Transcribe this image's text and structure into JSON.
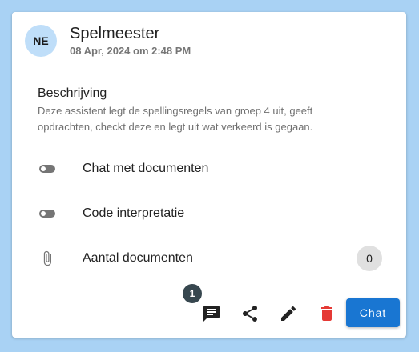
{
  "card": {
    "avatar_initials": "NE",
    "title": "Spelmeester",
    "subtitle": "08 Apr, 2024 om 2:48 PM",
    "description_label": "Beschrijving",
    "description_text": "Deze assistent legt de spellingsregels van groep 4 uit, geeft opdrachten, checkt deze en legt uit wat verkeerd is gegaan."
  },
  "settings": [
    {
      "label": "Chat met documenten",
      "icon": "toggle-icon",
      "enabled": false
    },
    {
      "label": "Code interpretatie",
      "icon": "toggle-icon",
      "enabled": false
    },
    {
      "label": "Aantal documenten",
      "icon": "paperclip-icon",
      "count": "0"
    }
  ],
  "actions": {
    "chat_notification_count": "1",
    "chat_button_label": "Chat",
    "icons": [
      "chat-bubble-icon",
      "share-icon",
      "edit-icon",
      "delete-icon"
    ]
  },
  "colors": {
    "background": "#a9d2f4",
    "primary": "#1976d2",
    "delete": "#e53935",
    "avatar_bg": "#bfdef9"
  }
}
